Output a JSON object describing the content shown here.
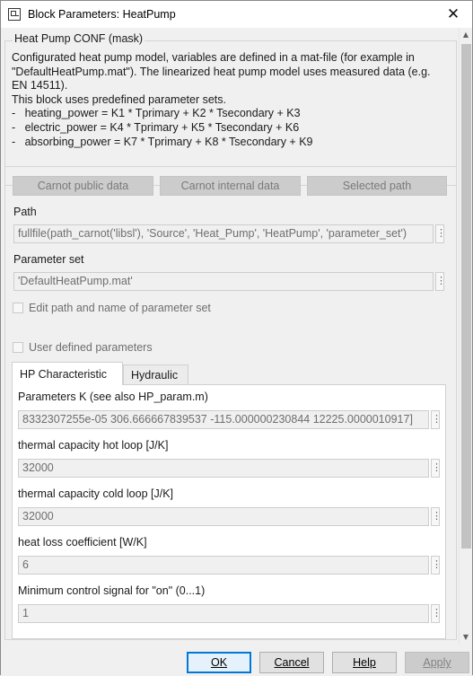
{
  "window": {
    "title": "Block Parameters: HeatPump",
    "close_glyph": "✕"
  },
  "mask": {
    "group_label": "Heat Pump CONF (mask)",
    "description_lines": [
      "Configurated heat pump model, variables are defined in a mat-file (for example in",
      "\"DefaultHeatPump.mat\"). The linearized heat pump model uses measured data (e.g.",
      "EN 14511).",
      "This block uses predefined parameter sets.",
      "-   heating_power = K1 * Tprimary + K2 * Tsecondary + K3",
      "-   electric_power = K4 * Tprimary + K5 * Tsecondary + K6",
      "-   absorbing_power = K7 * Tprimary + K8 * Tsecondary + K9"
    ]
  },
  "buttons": {
    "carnot_public": "Carnot public data",
    "carnot_internal": "Carnot internal data",
    "selected_path": "Selected path"
  },
  "path": {
    "label": "Path",
    "value": "fullfile(path_carnot('libsl'), 'Source', 'Heat_Pump', 'HeatPump', 'parameter_set')"
  },
  "parameter_set": {
    "label": "Parameter set",
    "value": "'DefaultHeatPump.mat'"
  },
  "edit_path_checkbox": {
    "label": "Edit path and name of parameter set",
    "checked": false
  },
  "user_defined_checkbox": {
    "label": "User defined parameters",
    "checked": false
  },
  "tabs": [
    {
      "label": "HP Characteristic",
      "active": true
    },
    {
      "label": "Hydraulic",
      "active": false
    }
  ],
  "hp_characteristic": {
    "params_k": {
      "label": "Parameters K (see also HP_param.m)",
      "value": "8332307255e-05 306.666667839537 -115.000000230844 12225.0000010917]"
    },
    "hot_capacity": {
      "label": "thermal capacity hot loop [J/K]",
      "value": "32000"
    },
    "cold_capacity": {
      "label": "thermal capacity cold loop [J/K]",
      "value": "32000"
    },
    "heat_loss": {
      "label": "heat loss coefficient [W/K]",
      "value": "6"
    },
    "min_control": {
      "label": "Minimum control signal for \"on\" (0...1)",
      "value": "1"
    }
  },
  "footer": {
    "ok": "OK",
    "cancel": "Cancel",
    "help": "Help",
    "apply": "Apply"
  },
  "more_glyph": "⋮",
  "scroll_up_glyph": "▲",
  "scroll_down_glyph": "▼"
}
